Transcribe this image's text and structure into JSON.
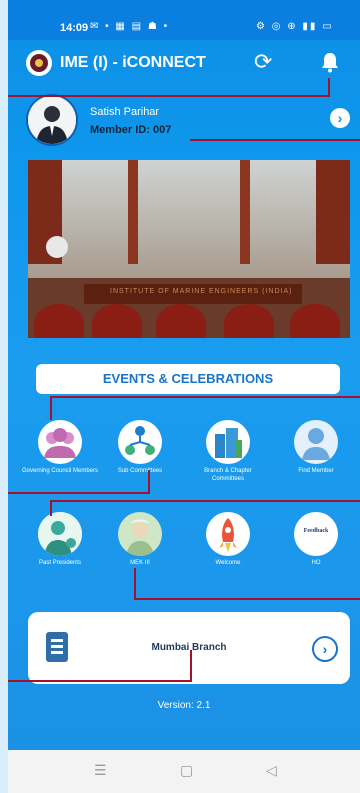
{
  "status_bar": {
    "time": "14:09",
    "left_icons": "✉ • ▦ ▤ ☗ •",
    "right_icons": "⚙ ◎ ⊕ ▮▮ ▭"
  },
  "app": {
    "title": "IME (I) - iCONNECT"
  },
  "profile": {
    "name": "Satish Parihar",
    "member_id": "Member ID: 007"
  },
  "banner": {
    "table_text": "INSTITUTE OF MARINE ENGINEERS (INDIA)"
  },
  "section": {
    "title": "EVENTS & CELEBRATIONS"
  },
  "grid_row1": [
    {
      "label": "Governing Council Members",
      "icon": "group-people-icon"
    },
    {
      "label": "Sub Committees",
      "icon": "org-network-icon"
    },
    {
      "label": "Branch & Chapter Committees",
      "icon": "building-icon"
    },
    {
      "label": "Find Member",
      "icon": "person-search-icon"
    }
  ],
  "grid_row2": [
    {
      "label": "Past Presidents",
      "icon": "president-icon"
    },
    {
      "label": "MEK III",
      "icon": "mek-icon"
    },
    {
      "label": "Welcome",
      "icon": "rocket-icon"
    },
    {
      "label": "HO",
      "icon": "feedback-icon",
      "badge_text": "Feedback"
    }
  ],
  "branch": {
    "name": "Mumbai Branch"
  },
  "version": "Version: 2.1",
  "nav": {
    "menu": "☰",
    "home": "▢",
    "back": "◁"
  },
  "colors": {
    "primary": "#0d8fe6",
    "callout": "#a2122b",
    "accent": "#1c74c8"
  }
}
